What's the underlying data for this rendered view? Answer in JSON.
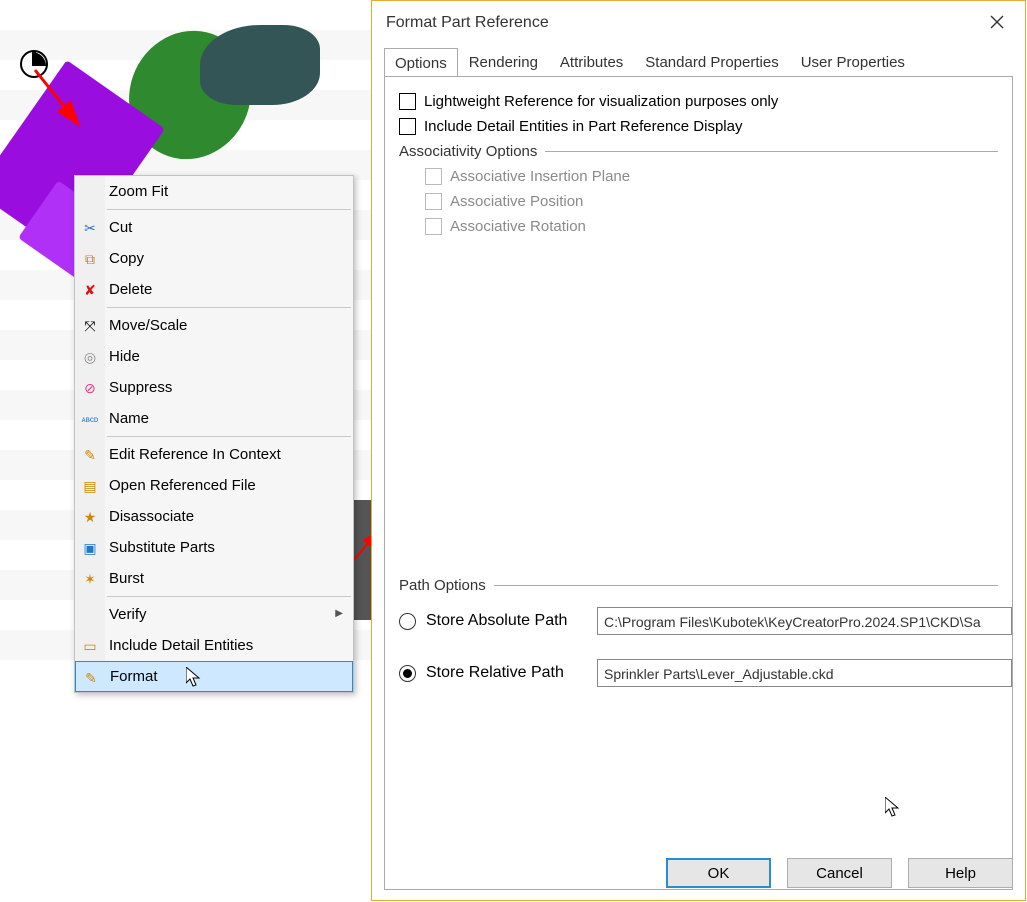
{
  "context_menu": {
    "items": [
      {
        "label": "Zoom Fit",
        "icon": ""
      },
      {
        "label": "Cut",
        "icon": "✂"
      },
      {
        "label": "Copy",
        "icon": "⧉"
      },
      {
        "label": "Delete",
        "icon": "✘"
      },
      {
        "label": "Move/Scale",
        "icon": "⤧"
      },
      {
        "label": "Hide",
        "icon": "◎"
      },
      {
        "label": "Suppress",
        "icon": "⊘"
      },
      {
        "label": "Name",
        "icon": "ᴀʙᴄᴅ"
      },
      {
        "label": "Edit Reference In Context",
        "icon": "✎"
      },
      {
        "label": "Open Referenced File",
        "icon": "▤"
      },
      {
        "label": "Disassociate",
        "icon": "★"
      },
      {
        "label": "Substitute Parts",
        "icon": "▣"
      },
      {
        "label": "Burst",
        "icon": "✶"
      },
      {
        "label": "Verify",
        "icon": "",
        "submenu": true
      },
      {
        "label": "Include Detail Entities",
        "icon": "▭"
      },
      {
        "label": "Format",
        "icon": "✎",
        "highlight": true
      }
    ]
  },
  "dialog": {
    "title": "Format Part Reference",
    "tabs": [
      "Options",
      "Rendering",
      "Attributes",
      "Standard Properties",
      "User Properties"
    ],
    "checkbox_lightweight": "Lightweight Reference for visualization purposes only",
    "checkbox_detail": "Include Detail Entities in Part Reference Display",
    "assoc_group": "Associativity Options",
    "assoc": {
      "plane": "Associative Insertion Plane",
      "position": "Associative Position",
      "rotation": "Associative Rotation"
    },
    "path_group": "Path Options",
    "radio_abs": "Store Absolute Path",
    "radio_rel": "Store Relative Path",
    "abs_value": "C:\\Program Files\\Kubotek\\KeyCreatorPro.2024.SP1\\CKD\\Sa",
    "rel_value": "Sprinkler Parts\\Lever_Adjustable.ckd",
    "buttons": {
      "ok": "OK",
      "cancel": "Cancel",
      "help": "Help"
    }
  }
}
